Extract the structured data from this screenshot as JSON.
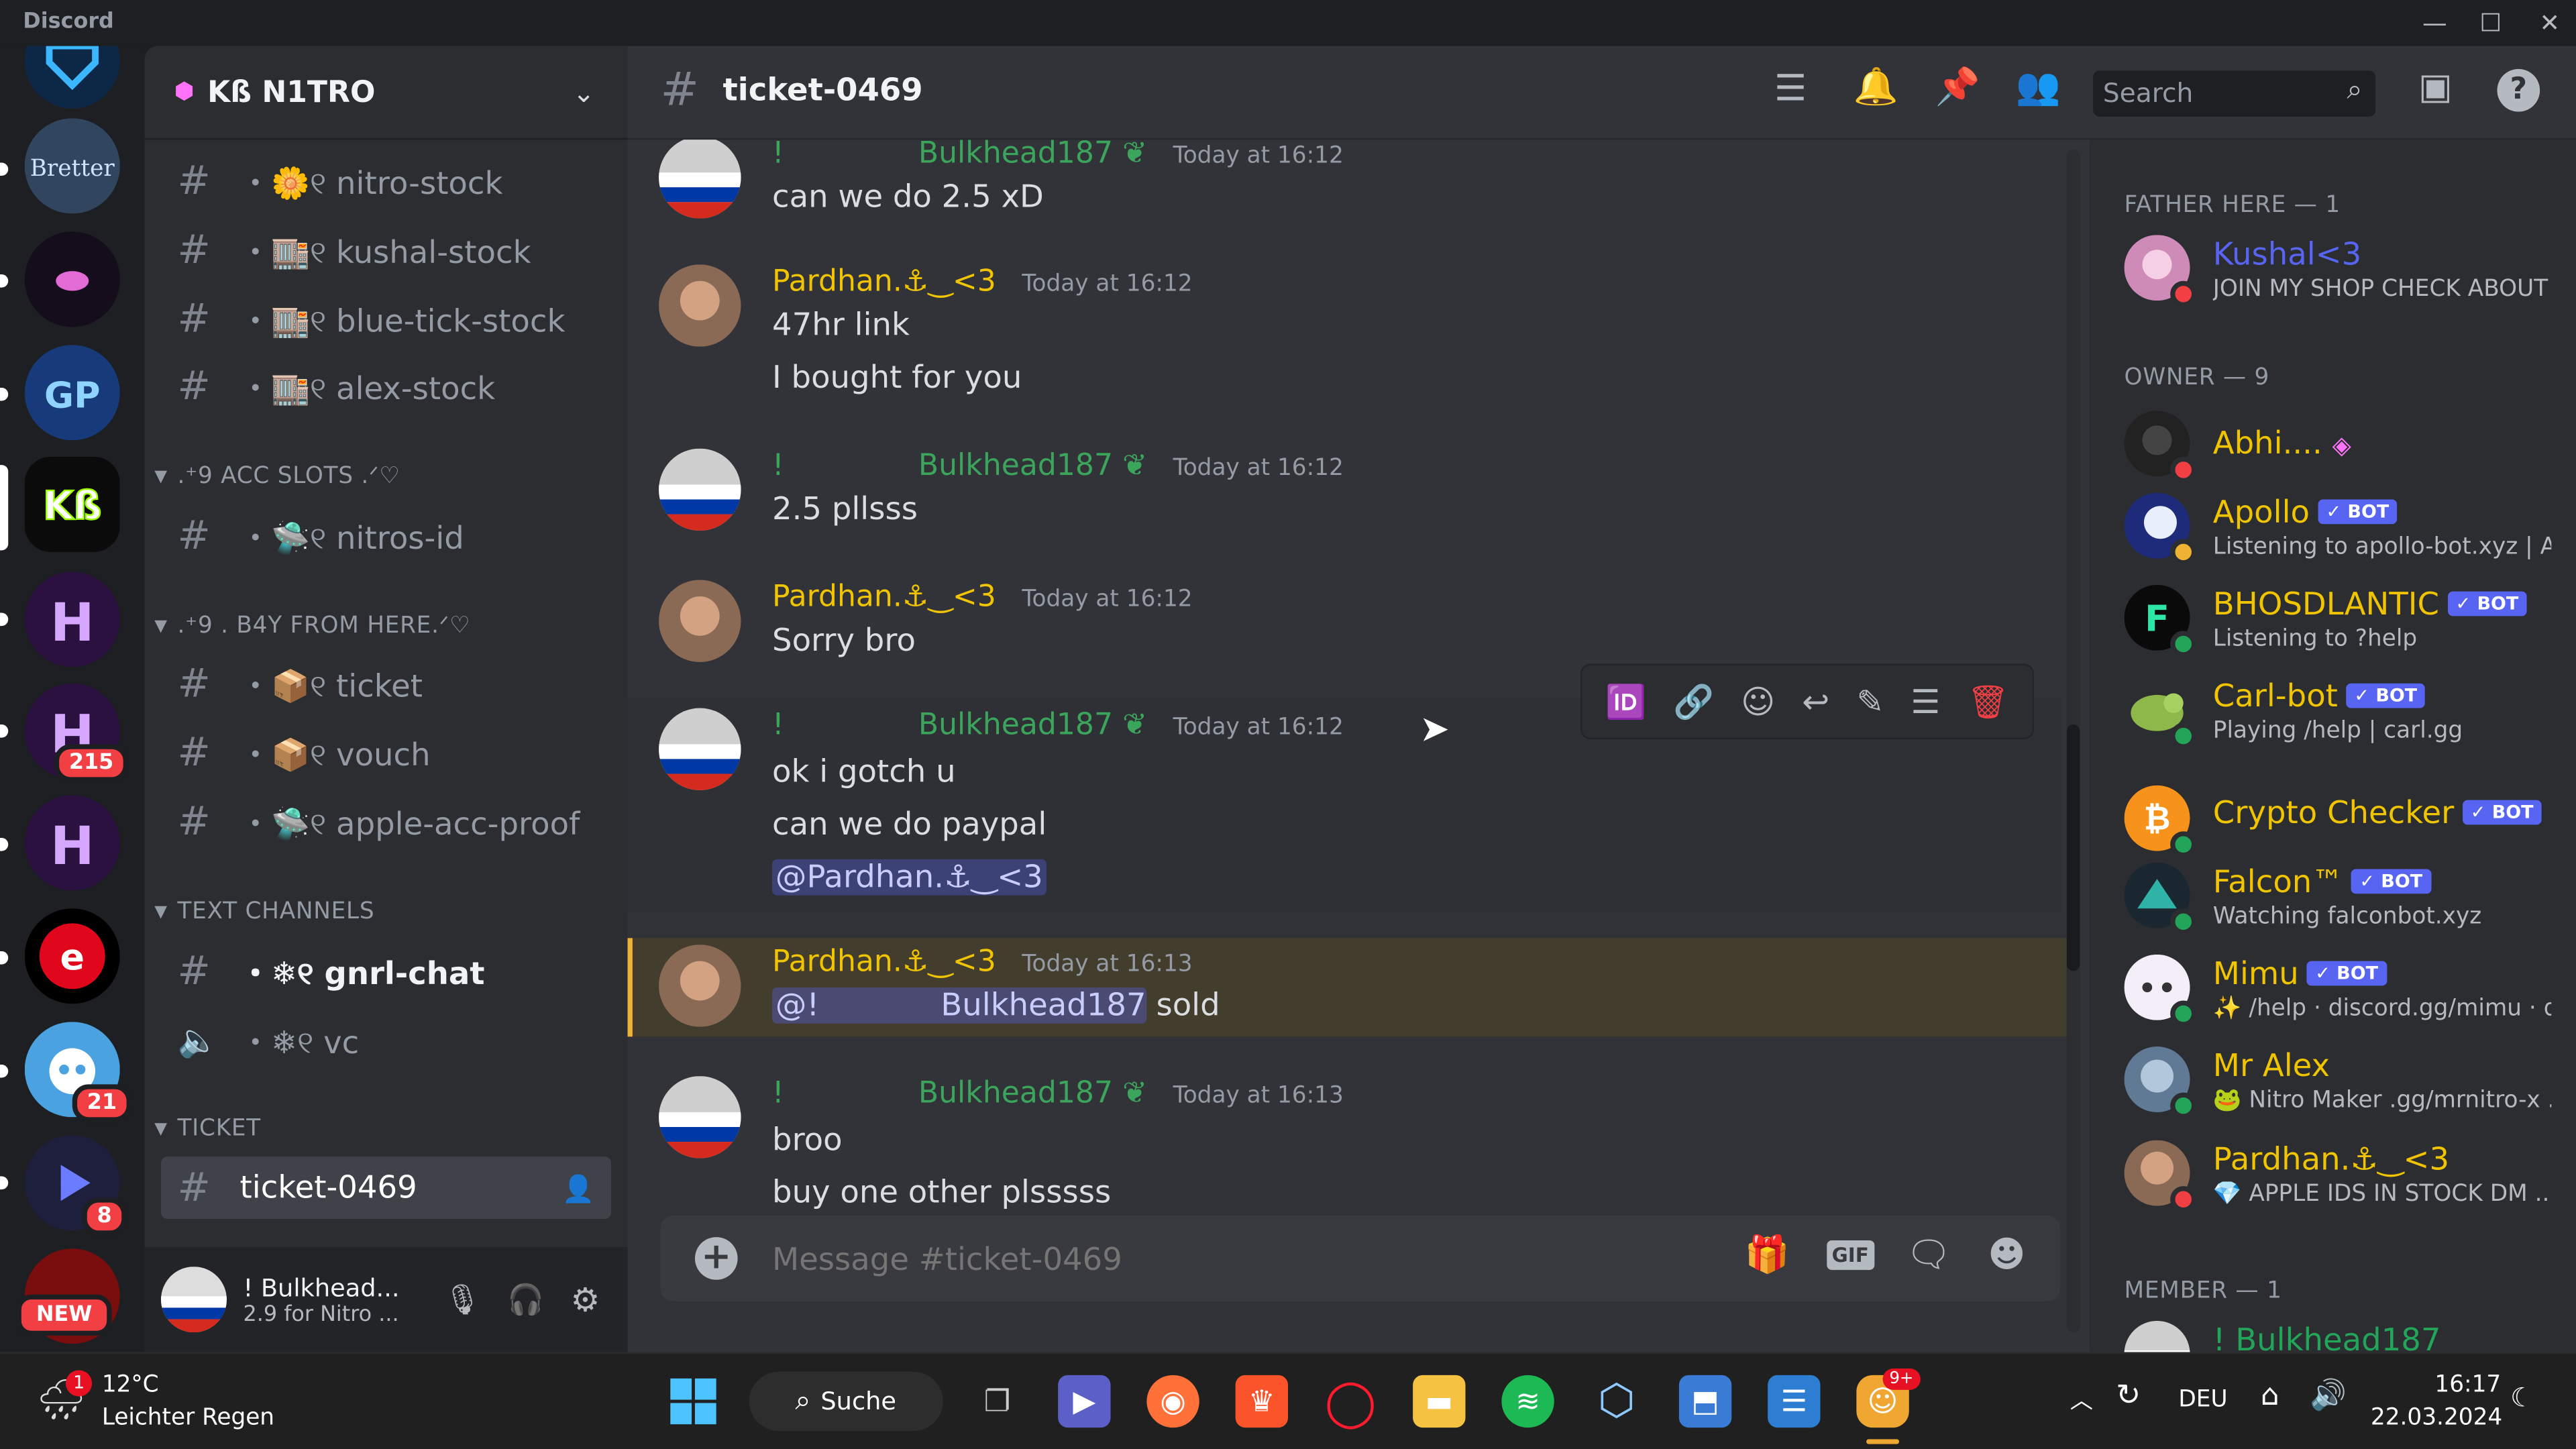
{
  "app": {
    "brand": "Discord",
    "min": "—",
    "max": "☐",
    "close": "✕"
  },
  "rail": {
    "badges": {
      "h2": "215",
      "bot": "21",
      "music": "8"
    },
    "new_label": "NEW"
  },
  "guild": {
    "name": "Kß N1TRO"
  },
  "channels": [
    {
      "name": "・🌼୧ nitro-stock"
    },
    {
      "name": "・🏬୧ kushal-stock"
    },
    {
      "name": "・🏬୧ blue-tick-stock"
    },
    {
      "name": "・🏬୧ alex-stock"
    }
  ],
  "categories": {
    "acc_slots": ".⁺9 ACC SLOTS .ᐟ♡",
    "buy": ".⁺9 . B4Y FROM HERE.ᐟ♡",
    "text": "TEXT CHANNELS",
    "ticket": "TICKET"
  },
  "acc_channels": [
    {
      "name": "・🛸୧ nitros-id"
    }
  ],
  "buy_channels": [
    {
      "name": "・📦୧ ticket"
    },
    {
      "name": "・📦୧ vouch"
    },
    {
      "name": "・🛸୧ apple-acc-proof"
    }
  ],
  "text_channels": [
    {
      "name": "・❄୧ gnrl-chat"
    },
    {
      "name": "・❄୧ vc"
    }
  ],
  "ticket_channel": {
    "name": "ticket-0469"
  },
  "user": {
    "name": "! Bulkhead...",
    "status": "2.9 for Nitro ..."
  },
  "header": {
    "channel": "ticket-0469",
    "search_placeholder": "Search"
  },
  "messages": [
    {
      "author_prefix": "!",
      "author": "Bulkhead187",
      "time": "Today at 16:12",
      "lines": [
        "can we do 2.5 xD"
      ]
    },
    {
      "author": "Pardhan.⚓︎‿<3",
      "time": "Today at 16:12",
      "lines": [
        "47hr link",
        "I bought for you"
      ]
    },
    {
      "author_prefix": "!",
      "author": "Bulkhead187",
      "time": "Today at 16:12",
      "lines": [
        "2.5 pllsss"
      ]
    },
    {
      "author": "Pardhan.⚓︎‿<3",
      "time": "Today at 16:12",
      "lines": [
        "Sorry bro"
      ]
    },
    {
      "author_prefix": "!",
      "author": "Bulkhead187",
      "time": "Today at 16:12",
      "lines": [
        "ok i gotch u",
        "can we do paypal"
      ],
      "mention": "@Pardhan.⚓︎‿<3"
    },
    {
      "author": "Pardhan.⚓︎‿<3",
      "time": "Today at 16:13",
      "mention_prefix": "@!",
      "mention": "Bulkhead187",
      "after": "sold"
    },
    {
      "author_prefix": "!",
      "author": "Bulkhead187",
      "time": "Today at 16:13",
      "lines": [
        "broo",
        "buy one other plsssss"
      ]
    }
  ],
  "composer": {
    "placeholder": "Message #ticket-0469",
    "gif": "GIF"
  },
  "members": {
    "groups": [
      "FATHER HERE — 1",
      "OWNER — 9",
      "MEMBER — 1"
    ],
    "list": [
      {
        "name": "Kushal<3",
        "status": "JOIN MY SHOP CHECK ABOUT",
        "color": "#5865f2"
      },
      {
        "name": "Abhi....",
        "status": "",
        "color": "#f0c400"
      },
      {
        "name": "Apollo",
        "status": "Listening to apollo-bot.xyz | A...",
        "bot": "✓ BOT",
        "color": "#f0c400"
      },
      {
        "name": "BHOSDLANTIC",
        "status": "Listening to ?help",
        "bot": "✓ BOT",
        "color": "#f0c400"
      },
      {
        "name": "Carl-bot",
        "status": "Playing /help | carl.gg",
        "bot": "✓ BOT",
        "color": "#f0c400"
      },
      {
        "name": "Crypto Checker",
        "status": "",
        "bot": "✓ BOT",
        "color": "#f0c400"
      },
      {
        "name": "Falcon™",
        "status": "Watching falconbot.xyz",
        "bot": "✓ BOT",
        "color": "#f0c400"
      },
      {
        "name": "Mimu",
        "status": "✨ /help · discord.gg/mimu · d...",
        "bot": "✓ BOT",
        "color": "#f0c400"
      },
      {
        "name": "Mr Alex",
        "status": "🐸 Nitro Maker .gg/mrnitro-x ...",
        "color": "#f0c400"
      },
      {
        "name": "Pardhan.⚓︎‿<3",
        "status": "💎 APPLE IDS IN STOCK DM ...",
        "color": "#f0c400"
      },
      {
        "name": "! Bulkhead187",
        "status": "",
        "color": "#23a559"
      }
    ]
  },
  "taskbar": {
    "weather_temp": "12°C",
    "weather_desc": "Leichter Regen",
    "weather_badge": "1",
    "search_label": "Suche",
    "lang": "DEU",
    "time": "16:17",
    "date": "22.03.2024",
    "discord_badge": "9+"
  },
  "colors": {
    "green": "#3ba55c",
    "yellow": "#f0c400",
    "blurple": "#5865f2",
    "red": "#f23f43"
  }
}
